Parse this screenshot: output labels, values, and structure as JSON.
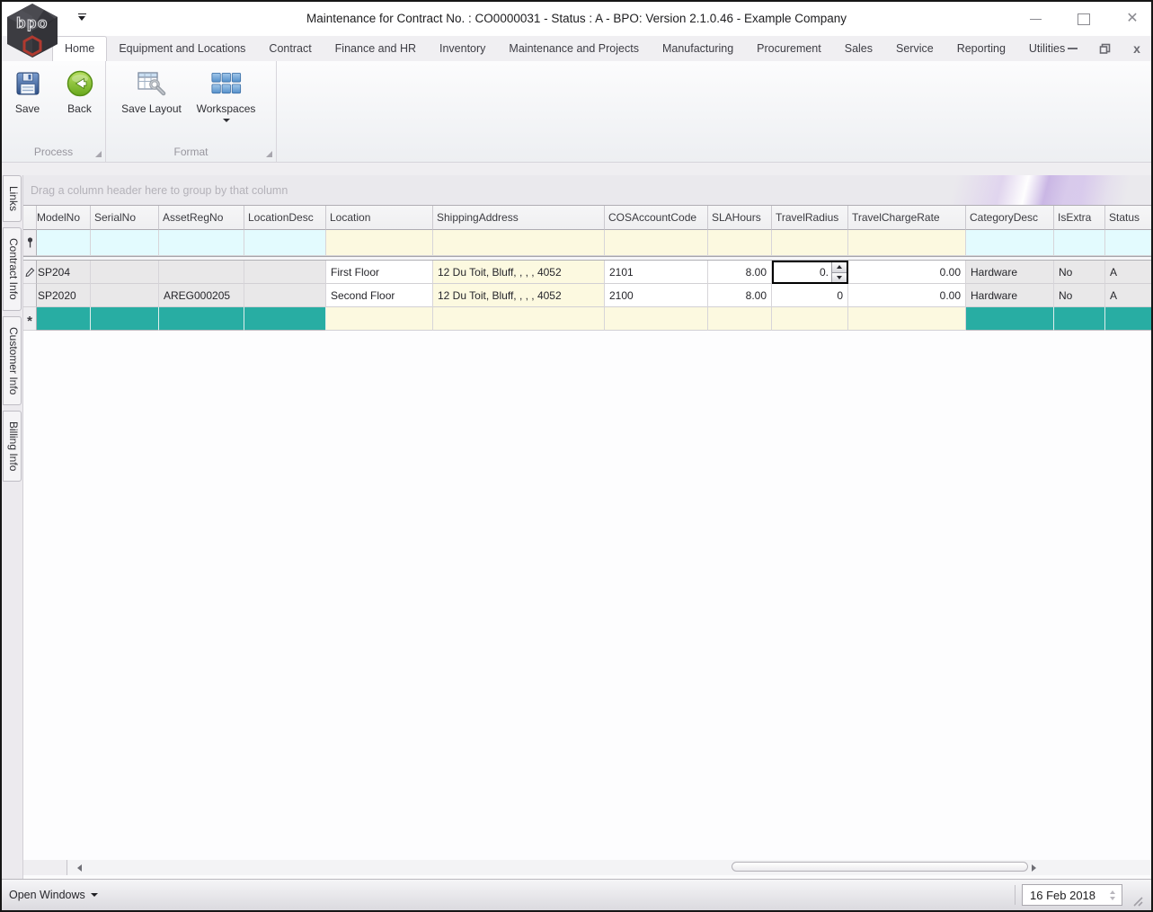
{
  "window": {
    "title": "Maintenance for Contract No. : CO0000031 - Status : A - BPO: Version 2.1.0.46 - Example Company",
    "logo_text": "bpo"
  },
  "ribbon": {
    "tabs": [
      "Home",
      "Equipment and Locations",
      "Contract",
      "Finance and HR",
      "Inventory",
      "Maintenance and Projects",
      "Manufacturing",
      "Procurement",
      "Sales",
      "Service",
      "Reporting",
      "Utilities"
    ],
    "active_tab": "Home",
    "buttons": {
      "save": "Save",
      "back": "Back",
      "save_layout": "Save Layout",
      "workspaces": "Workspaces"
    },
    "groups": {
      "process": "Process",
      "format": "Format"
    }
  },
  "sidebar": {
    "tabs": [
      {
        "label": "Links"
      },
      {
        "label": "Contract Info"
      },
      {
        "label": "Customer Info"
      },
      {
        "label": "Billing Info"
      }
    ]
  },
  "grid": {
    "group_panel_text": "Drag a column header here to group by that column",
    "columns": [
      "ModelNo",
      "SerialNo",
      "AssetRegNo",
      "LocationDesc",
      "Location",
      "ShippingAddress",
      "COSAccountCode",
      "SLAHours",
      "TravelRadius",
      "TravelChargeRate",
      "CategoryDesc",
      "IsExtra",
      "Status"
    ],
    "rows": [
      {
        "model_no": "SP204",
        "serial_no": "",
        "asset_reg_no": "",
        "location_desc": "",
        "location": "First Floor",
        "shipping_address": "12 Du Toit, Bluff, , , , 4052",
        "cos_account_code": "2101",
        "sla_hours": "8.00",
        "travel_radius": "0.",
        "travel_charge_rate": "0.00",
        "category_desc": "Hardware",
        "is_extra": "No",
        "status": "A",
        "state": "editing"
      },
      {
        "model_no": "SP2020",
        "serial_no": "",
        "asset_reg_no": "AREG000205",
        "location_desc": "",
        "location": "Second Floor",
        "shipping_address": "12 Du Toit, Bluff, , , , 4052",
        "cos_account_code": "2100",
        "sla_hours": "8.00",
        "travel_radius": "0",
        "travel_charge_rate": "0.00",
        "category_desc": "Hardware",
        "is_extra": "No",
        "status": "A",
        "state": ""
      }
    ],
    "selected_cell": {
      "row": 0,
      "column": "TravelRadius",
      "editor_value": "0."
    },
    "new_row_marker": "*"
  },
  "status_bar": {
    "open_windows_label": "Open Windows",
    "date_value": "16 Feb 2018"
  },
  "colors": {
    "teal": "#28ada3",
    "filter_cyan": "#e3fbfe",
    "cream": "#fcf9e0",
    "readonly_gray": "#e9e8e9",
    "selection_border": "#000000"
  },
  "icons": {
    "logo": "bpo-hexagon-logo",
    "quick_access": "chevron-down",
    "save": "floppy-disk",
    "back": "green-back-arrow",
    "save_layout": "table-wrench",
    "workspaces": "blue-tile-grid",
    "filter_row": "pin",
    "editing_row": "pencil",
    "new_row": "asterisk",
    "minimize": "minimize-dash",
    "maximize": "maximize-square",
    "restore": "restore-windows",
    "close": "close-x",
    "scroll_left": "arrow-left",
    "scroll_right": "arrow-right",
    "resize_grip": "diagonal-grip"
  }
}
